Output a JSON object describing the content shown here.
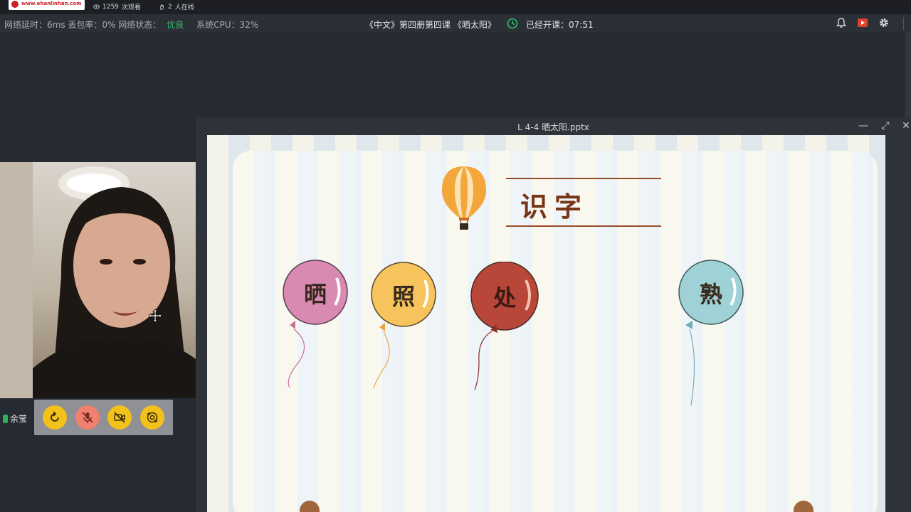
{
  "topbar": {
    "logo_text": "www.ehanlinhan.com",
    "views_count": "1259",
    "views_label": "次观看",
    "online_count": "2",
    "online_label": "人在线"
  },
  "statusbar": {
    "latency": "网络延时：6ms",
    "loss": "丢包率：0%",
    "network_label": "网络状态：",
    "network_value": "优良",
    "cpu": "系统CPU：32%",
    "course_title": "《中文》第四册第四课 《晒太阳》",
    "elapsed_label": "已经开课：07:51",
    "good_color": "#2fbf6f"
  },
  "document": {
    "filename": "L 4-4 晒太阳.pptx",
    "minimize": "—",
    "maximize": "⤢",
    "close": "✕"
  },
  "slide": {
    "heading": "识字",
    "balloons": [
      {
        "char": "晒",
        "color": "#d88ab3"
      },
      {
        "char": "照",
        "color": "#f6c35c"
      },
      {
        "char": "处",
        "color": "#b8473a"
      },
      {
        "char": "熟",
        "color": "#9fd2d6"
      }
    ]
  },
  "video": {
    "teacher_name": "余莹"
  },
  "controls": {
    "items": [
      {
        "name": "rotate-icon",
        "color": "#f2c21a"
      },
      {
        "name": "mic-off-icon",
        "color": "#f08070"
      },
      {
        "name": "camera-off-icon",
        "color": "#f2c21a"
      },
      {
        "name": "switch-camera-icon",
        "color": "#f2c21a"
      }
    ]
  }
}
